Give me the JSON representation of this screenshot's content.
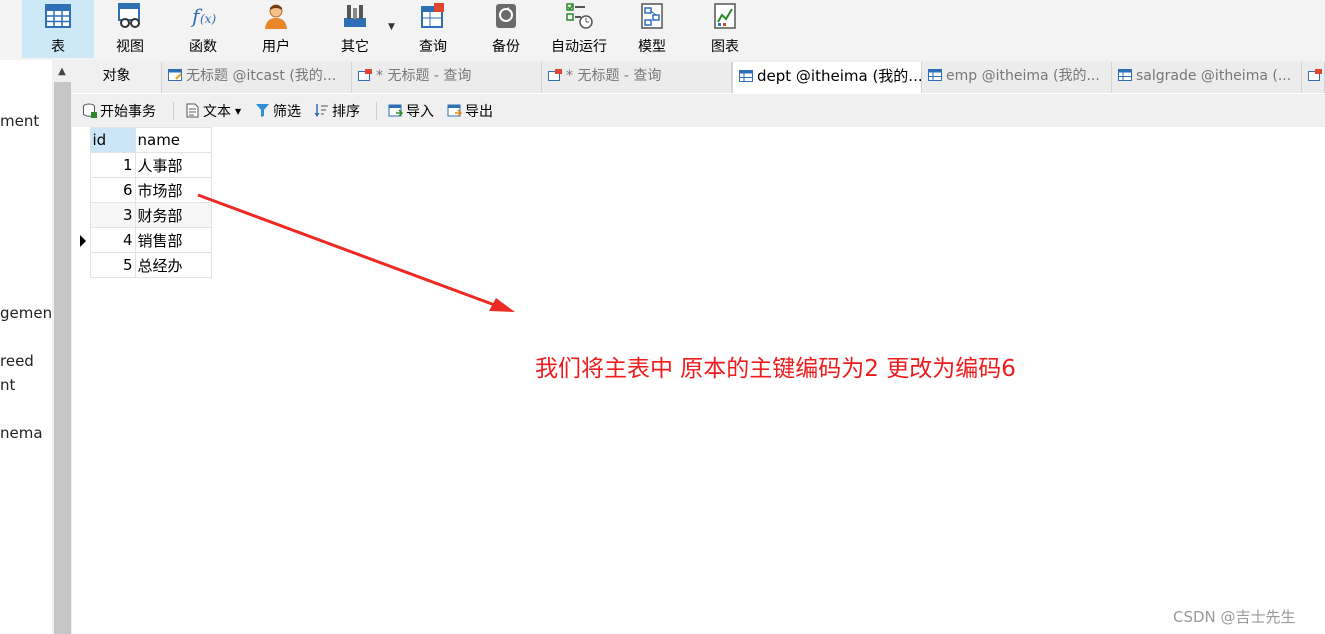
{
  "ribbon": {
    "buttons": [
      {
        "label": "表",
        "icon": "table-icon",
        "active": true
      },
      {
        "label": "视图",
        "icon": "view-icon"
      },
      {
        "label": "函数",
        "icon": "function-icon"
      },
      {
        "label": "用户",
        "icon": "user-icon"
      },
      {
        "label": "其它",
        "icon": "tools-icon"
      },
      {
        "label": "查询",
        "icon": "query-icon"
      },
      {
        "label": "备份",
        "icon": "backup-icon"
      },
      {
        "label": "自动运行",
        "icon": "automation-icon"
      },
      {
        "label": "模型",
        "icon": "model-icon"
      },
      {
        "label": "图表",
        "icon": "chart-icon"
      }
    ]
  },
  "left_panel": {
    "items": [
      "ment",
      "gement",
      "reed",
      "nt",
      "nema"
    ]
  },
  "tabs": [
    {
      "label": "对象"
    },
    {
      "label": "无标题 @itcast (我的..."
    },
    {
      "label": "* 无标题 - 查询"
    },
    {
      "label": "* 无标题 - 查询"
    },
    {
      "label": "dept @itheima (我的..."
    },
    {
      "label": "emp @itheima (我的..."
    },
    {
      "label": "salgrade @itheima (..."
    }
  ],
  "subtoolbar": {
    "begin_transaction": "开始事务",
    "text": "文本",
    "filter": "筛选",
    "sort": "排序",
    "import": "导入",
    "export": "导出"
  },
  "grid": {
    "columns": [
      "id",
      "name"
    ],
    "rows": [
      {
        "id": "1",
        "name": "人事部"
      },
      {
        "id": "6",
        "name": "市场部"
      },
      {
        "id": "3",
        "name": "财务部"
      },
      {
        "id": "4",
        "name": "销售部"
      },
      {
        "id": "5",
        "name": "总经办"
      }
    ],
    "current_row": 3
  },
  "annotation": "我们将主表中 原本的主键编码为2 更改为编码6",
  "watermark": "CSDN @吉士先生",
  "colors": {
    "accent": "#cde8f7",
    "annotation_red": "#ee1c1c"
  }
}
